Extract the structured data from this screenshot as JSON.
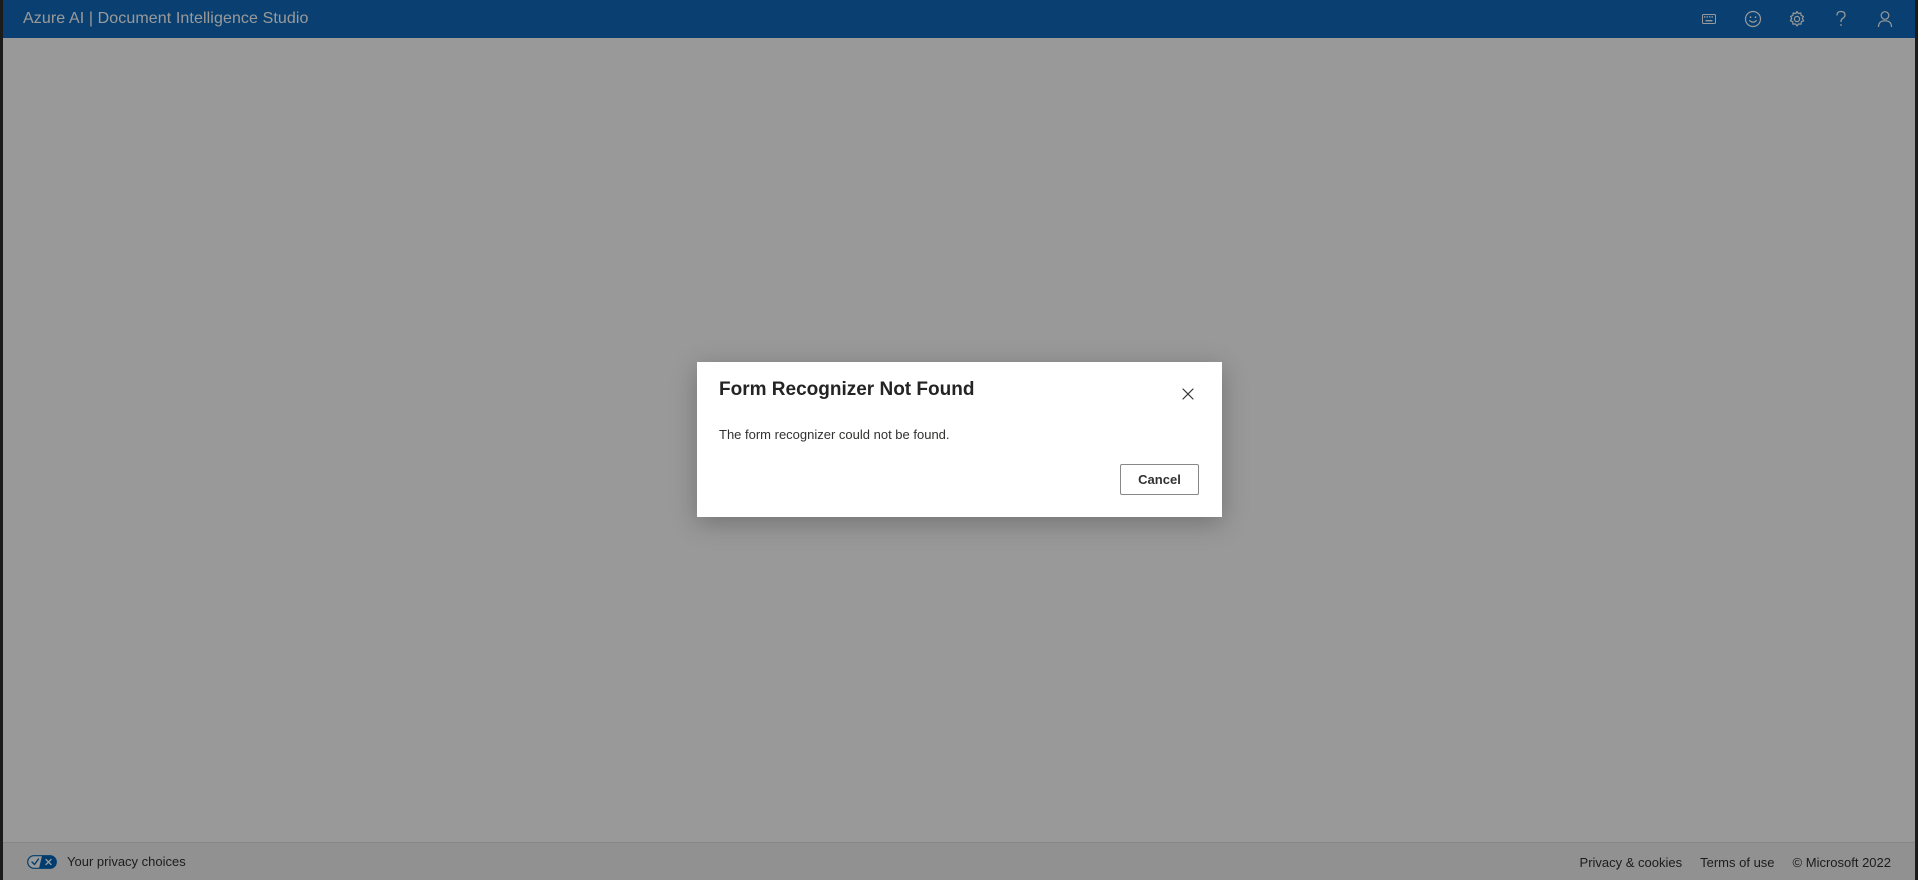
{
  "header": {
    "app_title": "Azure AI | Document Intelligence Studio",
    "icons": [
      "keyboard-icon",
      "smiley-feedback-icon",
      "gear-icon",
      "help-icon",
      "user-icon"
    ]
  },
  "dialog": {
    "title": "Form Recognizer Not Found",
    "message": "The form recognizer could not be found.",
    "cancel_label": "Cancel"
  },
  "footer": {
    "privacy_label": "Your privacy choices",
    "privacy_cookies_label": "Privacy & cookies",
    "terms_label": "Terms of use",
    "copyright": "© Microsoft 2022"
  },
  "colors": {
    "header_bg": "#0f6cbd",
    "overlay": "rgba(0,0,0,0.4)"
  }
}
